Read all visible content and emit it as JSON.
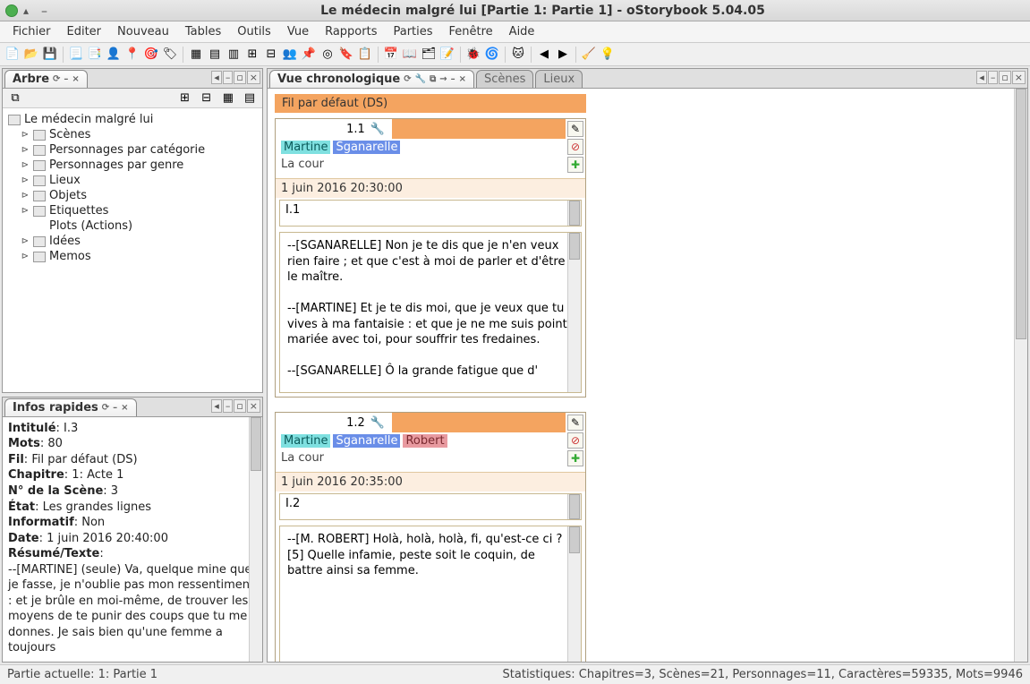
{
  "window": {
    "title": "Le médecin malgré lui [Partie 1: Partie 1] - oStorybook 5.04.05"
  },
  "menu": {
    "items": [
      "Fichier",
      "Editer",
      "Nouveau",
      "Tables",
      "Outils",
      "Vue",
      "Rapports",
      "Parties",
      "Fenêtre",
      "Aide"
    ]
  },
  "panels": {
    "arbre": {
      "title": "Arbre"
    },
    "infos": {
      "title": "Infos rapides"
    },
    "chrono": {
      "title": "Vue chronologique"
    },
    "tabs": {
      "scenes": "Scènes",
      "lieux": "Lieux"
    }
  },
  "tree": {
    "root": "Le médecin malgré lui",
    "items": [
      "Scènes",
      "Personnages par catégorie",
      "Personnages par genre",
      "Lieux",
      "Objets",
      "Etiquettes",
      "Plots (Actions)",
      "Idées",
      "Memos"
    ]
  },
  "infos": {
    "intitule": "Intitulé",
    "intitule_v": "I.3",
    "mots": "Mots",
    "mots_v": "80",
    "fil": "Fil",
    "fil_v": "Fil par défaut (DS)",
    "chapitre": "Chapitre",
    "chapitre_v": "1: Acte 1",
    "numscene": "N° de la Scène",
    "numscene_v": "3",
    "etat": "État",
    "etat_v": "Les grandes lignes",
    "informatif": "Informatif",
    "informatif_v": "Non",
    "date": "Date",
    "date_v": "1 juin 2016 20:40:00",
    "resume": "Résumé/Texte",
    "texte": "--[MARTINE] (seule) Va, quelque mine que je fasse, je n'oublie pas mon ressentiment : et je brûle en moi-même, de trouver les moyens de te punir des coups que tu me donnes. Je sais bien qu'une femme a toujours"
  },
  "chrono": {
    "strand": "Fil par défaut (DS)",
    "scenes": [
      {
        "num": "1.1",
        "chars": [
          {
            "n": "Martine",
            "c": "ch-martine"
          },
          {
            "n": "Sganarelle",
            "c": "ch-sgan"
          }
        ],
        "loc": "La cour",
        "date": "1 juin 2016 20:30:00",
        "title": "I.1",
        "text": "--[SGANARELLE] Non je te dis que je n'en veux rien faire ; et que c'est à moi de parler et d'être le maître.\n\n--[MARTINE] Et je te dis moi, que je veux que tu vives à ma fantaisie : et que je ne me suis point mariée avec toi, pour souffrir tes fredaines.\n\n--[SGANARELLE] Ô la grande fatigue que d'"
      },
      {
        "num": "1.2",
        "chars": [
          {
            "n": "Martine",
            "c": "ch-martine"
          },
          {
            "n": "Sganarelle",
            "c": "ch-sgan"
          },
          {
            "n": "Robert",
            "c": "ch-robert"
          }
        ],
        "loc": "La cour",
        "date": "1 juin 2016 20:35:00",
        "title": "I.2",
        "text": "--[M. ROBERT] Holà, holà, holà, fi, qu'est-ce ci ? [5] Quelle infamie, peste soit le coquin, de battre ainsi sa femme."
      }
    ]
  },
  "status": {
    "partie": "Partie actuelle: 1: Partie 1",
    "stats": "Statistiques: Chapitres=3,  Scènes=21,  Personnages=11,  Caractères=59335,  Mots=9946"
  }
}
